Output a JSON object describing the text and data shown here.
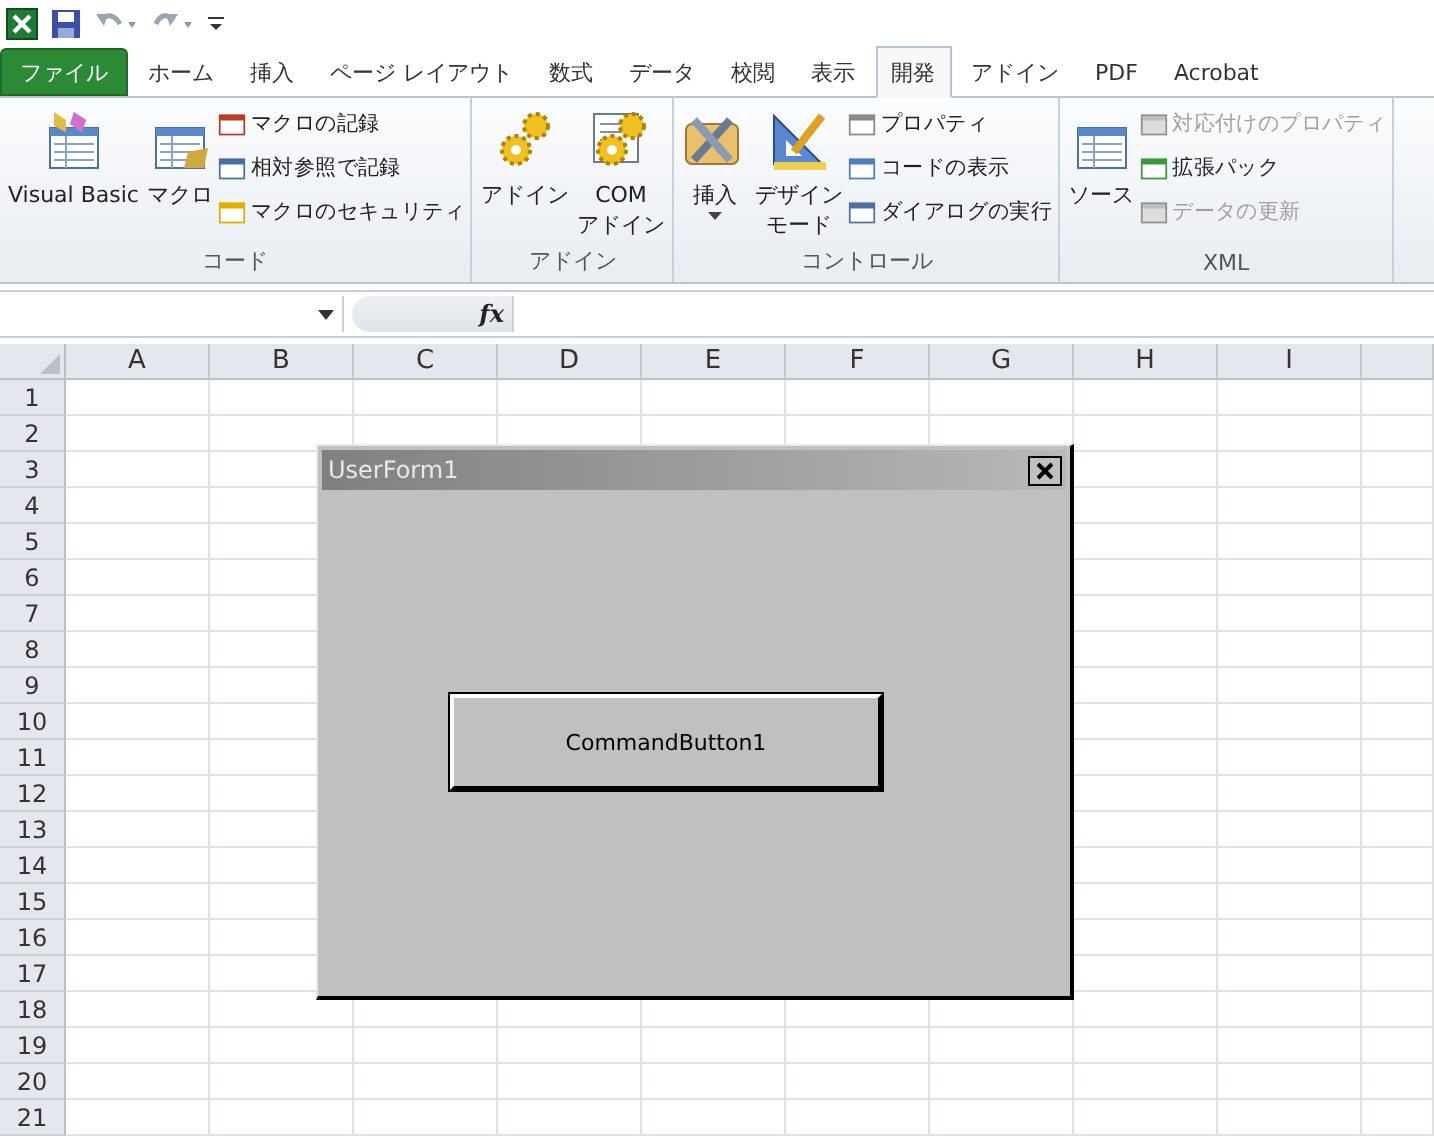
{
  "tabs": [
    {
      "label": "ファイル",
      "kind": "file",
      "selected": false
    },
    {
      "label": "ホーム",
      "kind": "tab",
      "selected": false
    },
    {
      "label": "挿入",
      "kind": "tab",
      "selected": false
    },
    {
      "label": "ページ レイアウト",
      "kind": "tab",
      "selected": false
    },
    {
      "label": "数式",
      "kind": "tab",
      "selected": false
    },
    {
      "label": "データ",
      "kind": "tab",
      "selected": false
    },
    {
      "label": "校閲",
      "kind": "tab",
      "selected": false
    },
    {
      "label": "表示",
      "kind": "tab",
      "selected": false
    },
    {
      "label": "開発",
      "kind": "tab",
      "selected": true
    },
    {
      "label": "アドイン",
      "kind": "tab",
      "selected": false
    },
    {
      "label": "PDF",
      "kind": "tab",
      "selected": false
    },
    {
      "label": "Acrobat",
      "kind": "tab",
      "selected": false
    }
  ],
  "ribbon": {
    "groups": [
      {
        "label": "コード",
        "large": [
          {
            "lines": [
              "Visual Basic"
            ],
            "dropdown": false
          },
          {
            "lines": [
              "マクロ"
            ],
            "dropdown": false
          }
        ],
        "small": [
          {
            "label": "マクロの記録",
            "disabled": false
          },
          {
            "label": "相対参照で記録",
            "disabled": false
          },
          {
            "label": "マクロのセキュリティ",
            "disabled": false
          }
        ]
      },
      {
        "label": "アドイン",
        "large": [
          {
            "lines": [
              "アドイン"
            ],
            "dropdown": false
          },
          {
            "lines": [
              "COM",
              "アドイン"
            ],
            "dropdown": false
          }
        ]
      },
      {
        "label": "コントロール",
        "large": [
          {
            "lines": [
              "挿入"
            ],
            "dropdown": true
          },
          {
            "lines": [
              "デザイン",
              "モード"
            ],
            "dropdown": false
          }
        ],
        "small": [
          {
            "label": "プロパティ",
            "disabled": false
          },
          {
            "label": "コードの表示",
            "disabled": false
          },
          {
            "label": "ダイアログの実行",
            "disabled": false
          }
        ]
      },
      {
        "label": "XML",
        "large": [
          {
            "lines": [
              "ソース"
            ],
            "dropdown": false
          }
        ],
        "small": [
          {
            "label": "対応付けのプロパティ",
            "disabled": true
          },
          {
            "label": "拡張パック",
            "disabled": false
          },
          {
            "label": "データの更新",
            "disabled": true
          }
        ]
      }
    ]
  },
  "formula_bar": {
    "function_label": "fx"
  },
  "sheet": {
    "columns": [
      "A",
      "B",
      "C",
      "D",
      "E",
      "F",
      "G",
      "H",
      "I"
    ],
    "rows": [
      "1",
      "2",
      "3",
      "4",
      "5",
      "6",
      "7",
      "8",
      "9",
      "10",
      "11",
      "12",
      "13",
      "14",
      "15",
      "16",
      "17",
      "18",
      "19",
      "20",
      "21"
    ]
  },
  "userform": {
    "title": "UserForm1",
    "button": "CommandButton1"
  }
}
